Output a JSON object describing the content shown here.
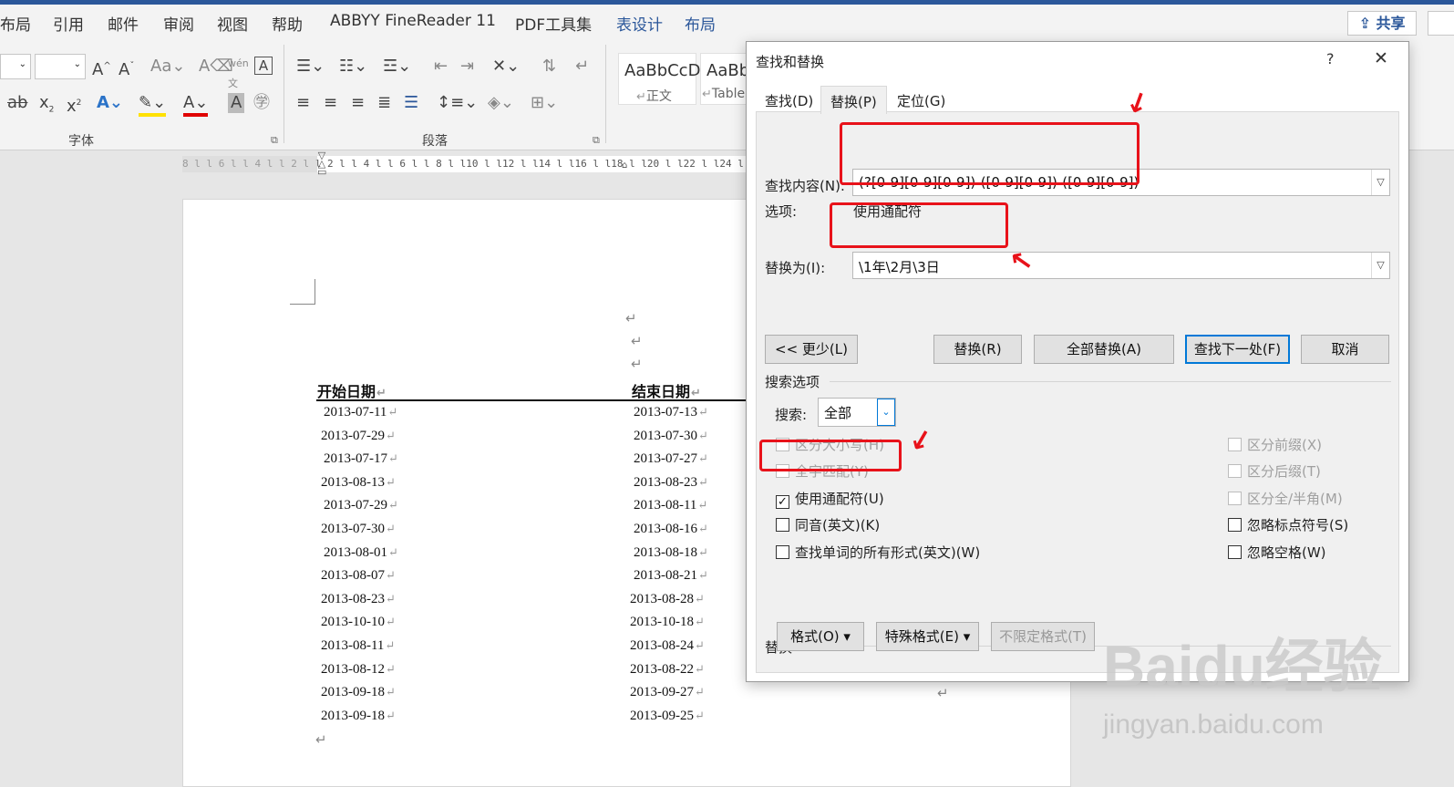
{
  "menu": {
    "items": [
      "布局",
      "引用",
      "邮件",
      "审阅",
      "视图",
      "帮助",
      "ABBYY FineReader 11",
      "PDF工具集",
      "表设计",
      "布局"
    ],
    "active_index": 8,
    "share_label": "共享"
  },
  "ribbon": {
    "font_group_label": "字体",
    "paragraph_group_label": "段落",
    "styles": [
      {
        "sample": "AaBbCcD",
        "name": "正文"
      },
      {
        "sample": "AaBb",
        "name": "Table"
      }
    ]
  },
  "ruler": {
    "text": "8 l   l 6 l   l 4 l   l 2 l      l 2 l   l 4 l   l 6 l   l 8 l   l10 l   l12 l   l14 l   l16 l   l18 l   l20 l   l22 l   l24 l   l26"
  },
  "document": {
    "header_start": "开始日期",
    "header_end": "结束日期",
    "rows": [
      {
        "start": "2013-07-11",
        "end": "2013-07-13"
      },
      {
        "start": "2013-07-29",
        "end": "2013-07-30"
      },
      {
        "start": "2013-07-17",
        "end": "2013-07-27"
      },
      {
        "start": "2013-08-13",
        "end": "2013-08-23"
      },
      {
        "start": "2013-07-29",
        "end": "2013-08-11"
      },
      {
        "start": "2013-07-30",
        "end": "2013-08-16"
      },
      {
        "start": "2013-08-01",
        "end": "2013-08-18"
      },
      {
        "start": "2013-08-07",
        "end": "2013-08-21"
      },
      {
        "start": "2013-08-23",
        "end": "2013-08-28"
      },
      {
        "start": "2013-10-10",
        "end": "2013-10-18"
      },
      {
        "start": "2013-08-11",
        "end": "2013-08-24"
      },
      {
        "start": "2013-08-12",
        "end": "2013-08-22"
      },
      {
        "start": "2013-09-18",
        "end": "2013-09-27"
      },
      {
        "start": "2013-09-18",
        "end": "2013-09-25"
      }
    ],
    "para_mark": "↵"
  },
  "dialog": {
    "title": "查找和替换",
    "help": "?",
    "close": "✕",
    "tabs": [
      "查找(D)",
      "替换(P)",
      "定位(G)"
    ],
    "selected_tab": 1,
    "find_label": "查找内容(N):",
    "find_value": "(?[0-9][0-9][0-9])-([0-9][0-9])-([0-9][0-9])",
    "options_label": "选项:",
    "options_value": "使用通配符",
    "replace_label": "替换为(I):",
    "replace_value": "\\1年\\2月\\3日",
    "buttons": {
      "less": "<< 更少(L)",
      "replace": "替换(R)",
      "replace_all": "全部替换(A)",
      "find_next": "查找下一处(F)",
      "cancel": "取消"
    },
    "search_options_title": "搜索选项",
    "search_label": "搜索:",
    "search_value": "全部",
    "left_checks": [
      {
        "label": "区分大小写(H)",
        "checked": false,
        "enabled": false
      },
      {
        "label": "全字匹配(Y)",
        "checked": false,
        "enabled": false
      },
      {
        "label": "使用通配符(U)",
        "checked": true,
        "enabled": true
      },
      {
        "label": "同音(英文)(K)",
        "checked": false,
        "enabled": true
      },
      {
        "label": "查找单词的所有形式(英文)(W)",
        "checked": false,
        "enabled": true
      }
    ],
    "right_checks": [
      {
        "label": "区分前缀(X)",
        "checked": false,
        "enabled": false
      },
      {
        "label": "区分后缀(T)",
        "checked": false,
        "enabled": false
      },
      {
        "label": "区分全/半角(M)",
        "checked": false,
        "enabled": false
      },
      {
        "label": "忽略标点符号(S)",
        "checked": false,
        "enabled": true
      },
      {
        "label": "忽略空格(W)",
        "checked": false,
        "enabled": true
      }
    ],
    "replace_section_title": "替换",
    "format_buttons": {
      "format": "格式(O) ▾",
      "special": "特殊格式(E) ▾",
      "no_format": "不限定格式(T)"
    }
  },
  "watermark": {
    "logo": "Baidu经验",
    "url": "jingyan.baidu.com"
  },
  "colors": {
    "accent": "#2b579a",
    "highlight_red": "#e8121a",
    "default_button_border": "#0078d7"
  }
}
